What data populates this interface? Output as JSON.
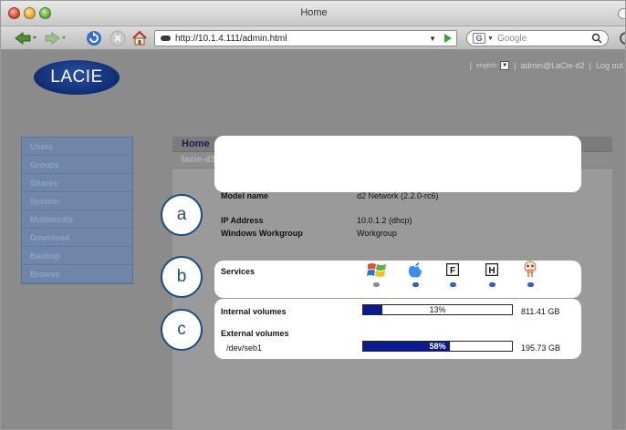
{
  "window": {
    "title": "Home"
  },
  "toolbar": {
    "url": "http://10.1.4.111/admin.html",
    "search_placeholder": "Google",
    "search_engine_letter": "G"
  },
  "header": {
    "logo_text": "LACIE",
    "language": "english",
    "user": "admin@LaCie-d2",
    "logout": "Log out",
    "sep1": "|",
    "sep2": "|",
    "sep3": "|"
  },
  "sidebar": {
    "items": [
      {
        "label": "Users"
      },
      {
        "label": "Groups"
      },
      {
        "label": "Shares"
      },
      {
        "label": "System"
      },
      {
        "label": "Multimedia"
      },
      {
        "label": "Download"
      },
      {
        "label": "Backup"
      },
      {
        "label": "Browse"
      }
    ]
  },
  "content": {
    "title": "Home",
    "device": "lacie-d3"
  },
  "device_info": {
    "model_label": "Model name",
    "model_value": "d2 Network (2.2.0-rc6)",
    "ip_label": "IP Address",
    "ip_value": "10.0.1.2 (dhcp)",
    "workgroup_label": "Windows Workgroup",
    "workgroup_value": "Workgroup"
  },
  "services": {
    "label": "Services",
    "items": [
      {
        "name": "windows",
        "icon": "windows-icon",
        "active": false
      },
      {
        "name": "apple",
        "icon": "apple-icon",
        "active": true
      },
      {
        "name": "ftp",
        "letter": "F",
        "icon": "ftp-icon",
        "active": true
      },
      {
        "name": "http",
        "letter": "H",
        "icon": "http-icon",
        "active": true
      },
      {
        "name": "media",
        "icon": "media-server-icon",
        "active": true
      }
    ]
  },
  "volumes": {
    "internal_label": "Internal volumes",
    "internal_percent": 13,
    "internal_percent_text": "13%",
    "internal_size": "811.41 GB",
    "external_label": "External volumes",
    "external_device": "/dev/seb1",
    "external_percent": 58,
    "external_percent_text": "58%",
    "external_size": "195.73 GB"
  },
  "callouts": {
    "a": "a",
    "b": "b",
    "c": "c"
  },
  "colors": {
    "callout_border": "#1d4f7e",
    "bar_fill": "#0b1a8e",
    "service_active": "#2f5fc8",
    "sidebar": "#6f86a8"
  }
}
